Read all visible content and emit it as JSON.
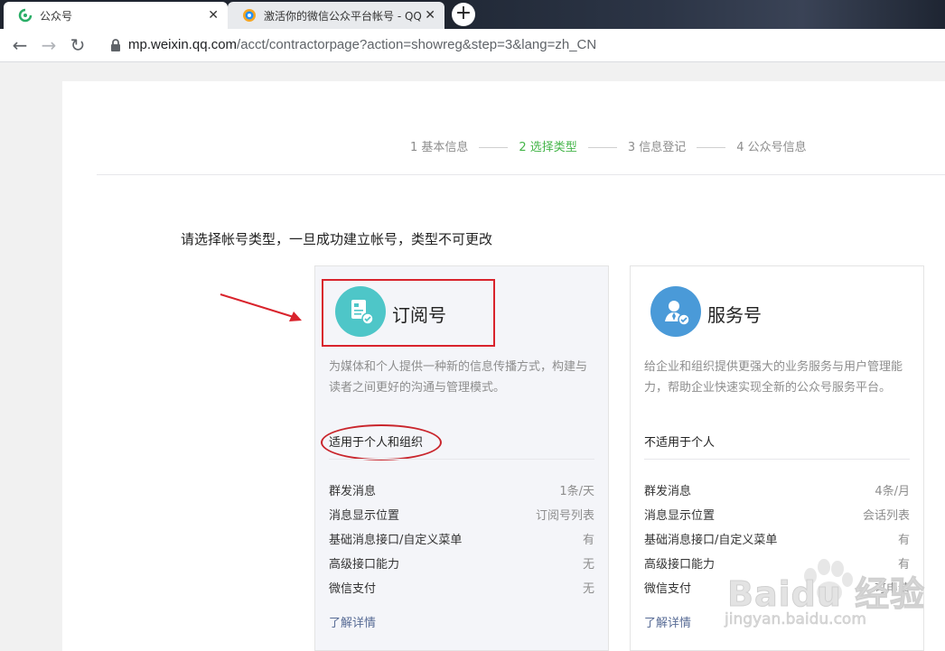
{
  "browser": {
    "tabs": [
      {
        "title": "公众号",
        "active": true
      },
      {
        "title": "激活你的微信公众平台帐号 - QQ",
        "active": false
      }
    ],
    "url_host": "mp.weixin.qq.com",
    "url_path": "/acct/contractorpage?action=showreg&step=3&lang=zh_CN"
  },
  "steps": [
    "1 基本信息",
    "2 选择类型",
    "3 信息登记",
    "4 公众号信息"
  ],
  "prompt": "请选择帐号类型，一旦成功建立帐号，类型不可更改",
  "cards": [
    {
      "name": "订阅号",
      "desc": "为媒体和个人提供一种新的信息传播方式，构建与读者之间更好的沟通与管理模式。",
      "suitable": "适用于个人和组织",
      "features": [
        {
          "label": "群发消息",
          "value": "1条/天"
        },
        {
          "label": "消息显示位置",
          "value": "订阅号列表"
        },
        {
          "label": "基础消息接口/自定义菜单",
          "value": "有"
        },
        {
          "label": "高级接口能力",
          "value": "无"
        },
        {
          "label": "微信支付",
          "value": "无"
        }
      ],
      "more": "了解详情",
      "icon_color": "#4ec6c8"
    },
    {
      "name": "服务号",
      "desc": "给企业和组织提供更强大的业务服务与用户管理能力，帮助企业快速实现全新的公众号服务平台。",
      "suitable": "不适用于个人",
      "features": [
        {
          "label": "群发消息",
          "value": "4条/月"
        },
        {
          "label": "消息显示位置",
          "value": "会话列表"
        },
        {
          "label": "基础消息接口/自定义菜单",
          "value": "有"
        },
        {
          "label": "高级接口能力",
          "value": "有"
        },
        {
          "label": "微信支付",
          "value": "可申请"
        }
      ],
      "more": "了解详情",
      "icon_color": "#4a9ad8"
    }
  ],
  "watermark": {
    "text": "Baidu 经验",
    "sub": "jingyan.baidu.com"
  },
  "colors": {
    "active_step": "#44b549",
    "annotation_red": "#d9232c",
    "link": "#576b95"
  }
}
